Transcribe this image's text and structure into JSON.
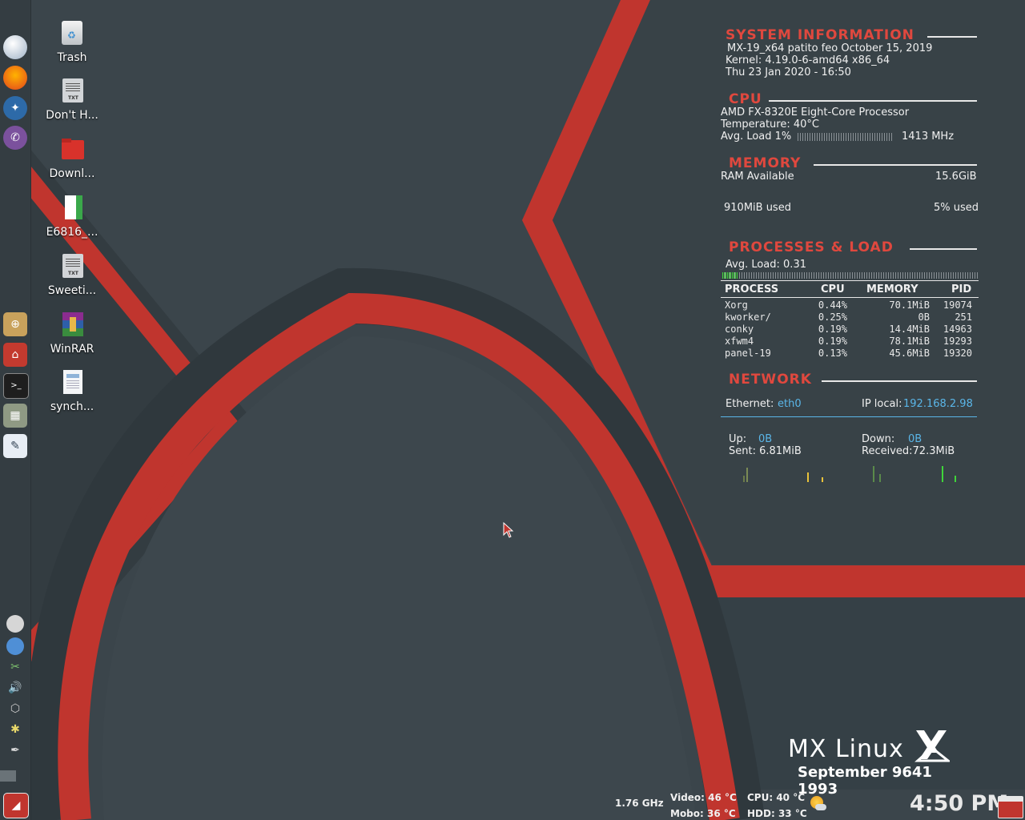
{
  "desktop": {
    "icons": [
      {
        "label": "Trash",
        "icon": "trash-icon"
      },
      {
        "label": "Don't H...",
        "icon": "text-file-icon"
      },
      {
        "label": "Downl...",
        "icon": "folder-icon"
      },
      {
        "label": "E6816_...",
        "icon": "document-icon"
      },
      {
        "label": "Sweeti...",
        "icon": "text-file-icon"
      },
      {
        "label": "WinRAR",
        "icon": "winrar-icon"
      },
      {
        "label": "synch...",
        "icon": "document-icon"
      }
    ]
  },
  "conky": {
    "sysinfo": {
      "heading": "SYSTEM INFORMATION",
      "distro": "MX-19_x64 patito feo October 15, 2019",
      "kernel": "Kernel: 4.19.0-6-amd64 x86_64",
      "datetime": "Thu 23 Jan 2020 - 16:50"
    },
    "cpu": {
      "heading": "CPU",
      "model": "AMD FX-8320E Eight-Core Processor",
      "temperature": "Temperature: 40°C",
      "avg_load_label": "Avg. Load 1%",
      "avg_load_percent": 1,
      "freq": "1413 MHz"
    },
    "memory": {
      "heading": "MEMORY",
      "ram_label": "RAM Available",
      "ram_value": "15.6GiB",
      "used": "910MiB used",
      "used_percent_label": "5% used"
    },
    "processes": {
      "heading": "PROCESSES & LOAD",
      "avg_load": "Avg. Load: 0.31",
      "load_fraction": 0.06,
      "columns": [
        "PROCESS",
        "CPU",
        "MEMORY",
        "PID"
      ],
      "rows": [
        [
          "Xorg",
          "0.44%",
          "70.1MiB",
          "19074"
        ],
        [
          "kworker/",
          "0.25%",
          "0B",
          "251"
        ],
        [
          "conky",
          "0.19%",
          "14.4MiB",
          "14963"
        ],
        [
          "xfwm4",
          "0.19%",
          "78.1MiB",
          "19293"
        ],
        [
          "panel-19",
          "0.13%",
          "45.6MiB",
          "19320"
        ]
      ]
    },
    "network": {
      "heading": "NETWORK",
      "ethernet_label": "Ethernet:",
      "ethernet_value": "eth0",
      "ip_label": "IP local:",
      "ip_value": "192.168.2.98",
      "up_label": "Up:",
      "up_value": "0B",
      "sent": "Sent: 6.81MiB",
      "down_label": "Down:",
      "down_value": "0B",
      "received": "Received:72.3MiB"
    }
  },
  "branding": {
    "logo_text": "MX Linux",
    "tagline": "September 9641 1993"
  },
  "bottom_bar": {
    "freq": "1.76 GHz",
    "video": "Video: 46 °C",
    "mobo": "Mobo: 36 °C",
    "cpu": "CPU: 40 °C",
    "hdd": "HDD: 33 °C",
    "clock": "4:50 PM"
  },
  "colors": {
    "accent_red": "#c0352e",
    "background": "#3b454b",
    "heading_red": "#e0483e",
    "link_blue": "#5ab6e8"
  }
}
